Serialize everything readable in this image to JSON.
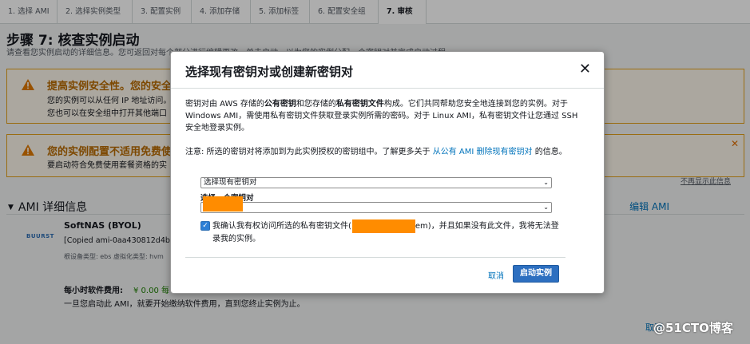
{
  "wizard": {
    "steps": [
      "1. 选择 AMI",
      "2. 选择实例类型",
      "3. 配置实例",
      "4. 添加存储",
      "5. 添加标签",
      "6. 配置安全组",
      "7. 审核"
    ],
    "title": "步骤 7: 核查实例启动",
    "description": "请查看您实例启动的详细信息。您可返回对每个部分进行编辑更改。单击启动，以为您的实例分配一个密钥对并完成启动过程。"
  },
  "alerts": {
    "security": {
      "title": "提高实例安全性。您的安全",
      "line1": "您的实例可以从任何 IP 地址访问。",
      "line2": "您也可以在安全组中打开其他端口"
    },
    "free_tier": {
      "title": "您的实例配置不适用免费使",
      "line1": "要启动符合免费使用套餐资格的实"
    },
    "dismiss": "不再显示此信息"
  },
  "ami": {
    "section_title": "AMI 详细信息",
    "edit": "编辑 AMI",
    "logo": "BUURST",
    "name": "SoftNAS (BYOL)",
    "copied": "[Copied ami-0aa430812d4b5c2",
    "meta": "根设备类型: ebs    虚拟化类型: hvm",
    "fee_label": "每小时软件费用:",
    "fee_value": "¥ 0.00 每",
    "fee_note": "一旦您启动此 AMI，就要开始缴纳软件费用，直到您终止实例为止。"
  },
  "background_cancel": "取消",
  "watermark": "@51CTO博客",
  "modal": {
    "title": "选择现有密钥对或创建新密钥对",
    "close": "✕",
    "para1": {
      "t1": "密钥对由 AWS 存储的",
      "b1": "公有密钥",
      "t2": "和您存储的",
      "b2": "私有密钥文件",
      "t3": "构成。它们共同帮助您安全地连接到您的实例。对于 Windows AMI，需使用私有密钥文件获取登录实例所需的密码。对于 Linux AMI，私有密钥文件让您通过 SSH 安全地登录实例。"
    },
    "para2": {
      "text": "注意: 所选的密钥对将添加到为此实例授权的密钥组中。了解更多关于",
      "link": "从公有 AMI 删除现有密钥对",
      "suffix": "的信息。"
    },
    "key_option_select": "选择现有密钥对",
    "key_pair_label": "选择一个密钥对",
    "key_pair_value": "",
    "ack": {
      "prefix": "我确认我有权访问所选的私有密钥文件(",
      "suffix": "em)，并且如果没有此文件，我将无法登录我的实例。"
    },
    "cancel": "取消",
    "launch": "启动实例"
  },
  "colors": {
    "accent_blue": "#0073bb",
    "primary_button": "#2d6fc0",
    "warning_orange": "#e4a11b",
    "redaction": "#ff8c00"
  }
}
